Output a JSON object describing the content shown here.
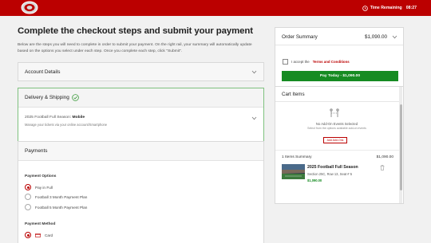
{
  "header": {
    "logo_icon": "ohio-state-logo",
    "timer_icon": "clock-icon",
    "timer_label": "Time Remaining",
    "timer_value": "08:27",
    "brand_color": "#bb0000"
  },
  "main": {
    "title": "Complete the checkout steps and submit your payment",
    "intro": "Below are the steps you will need to complete in order to submit your payment. On the right rail, your summary will automatically update based on the options you select under each step. Once you complete each step, click \"Submit\".",
    "account": {
      "title": "Account Details"
    },
    "delivery": {
      "title": "Delivery & Shipping",
      "season_prefix": "2025 Football Full Season:",
      "season_method": "Mobile",
      "note": "Manage your tickets via your online account/Smartphone"
    },
    "payments": {
      "title": "Payments",
      "options_label": "Payment Options",
      "options": [
        {
          "label": "Pay in Full",
          "selected": true
        },
        {
          "label": "Football 3 Month Payment Plan",
          "selected": false
        },
        {
          "label": "Football 5 Month Payment Plan",
          "selected": false
        }
      ],
      "method_label": "Payment Method",
      "method_card": "Card"
    }
  },
  "summary": {
    "title": "Order Summary",
    "amount": "$1,090.00",
    "accept_text": "I accept the",
    "terms_link": "Terms and Conditions",
    "pay_button": "Pay Today - $1,090.00",
    "pay_color": "#168b22"
  },
  "cart": {
    "title": "Cart Items",
    "addon_title": "No Add-On Events Selected",
    "addon_sub": "Select from the options available add-on events",
    "addon_button": "Add Add-Ons",
    "items_summary": "1 Items Summary",
    "items_total": "$1,090.00",
    "item": {
      "name": "2025 Football Full Season",
      "seat": "Section 25C, Row 13, Seat # 5",
      "price": "$1,090.00"
    }
  }
}
